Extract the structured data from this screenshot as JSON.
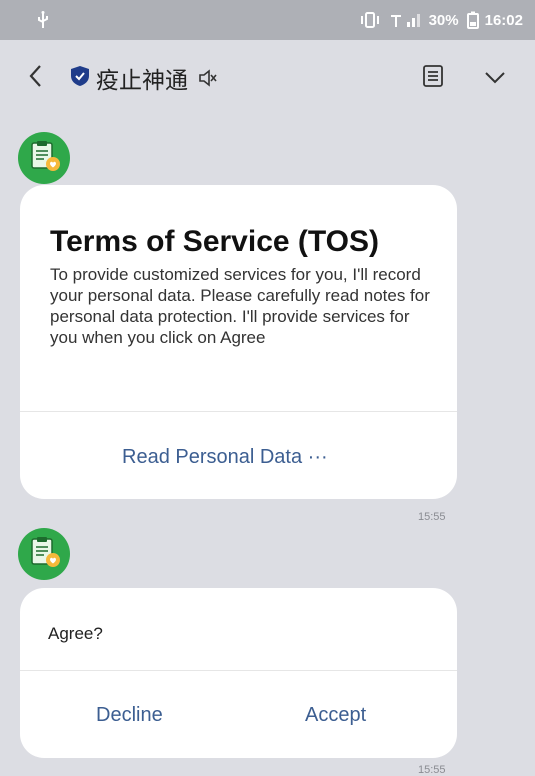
{
  "status_bar": {
    "battery": "30%",
    "time": "16:02",
    "icons": [
      "usb-icon",
      "vibrate-icon",
      "signal-icon",
      "battery-icon"
    ]
  },
  "header": {
    "title": "疫止神通",
    "icons": [
      "back-chevron-icon",
      "shield-icon",
      "mute-icon",
      "menu-list-icon",
      "chevron-down-icon"
    ]
  },
  "messages": [
    {
      "card": {
        "title": "Terms of Service (TOS)",
        "body": "To provide customized services for you, I'll record your personal data. Please carefully read notes for personal data protection. I'll provide services for you when you click on Agree",
        "action": "Read Personal Data ···"
      },
      "time": "15:55"
    },
    {
      "card": {
        "question": "Agree?",
        "decline": "Decline",
        "accept": "Accept"
      },
      "time": "15:55"
    }
  ],
  "colors": {
    "background": "#dcdde3",
    "status_bar": "#aeb0b6",
    "action_text": "#3c5e91",
    "avatar": "#2fa84a",
    "shield": "#1f3c8a"
  }
}
